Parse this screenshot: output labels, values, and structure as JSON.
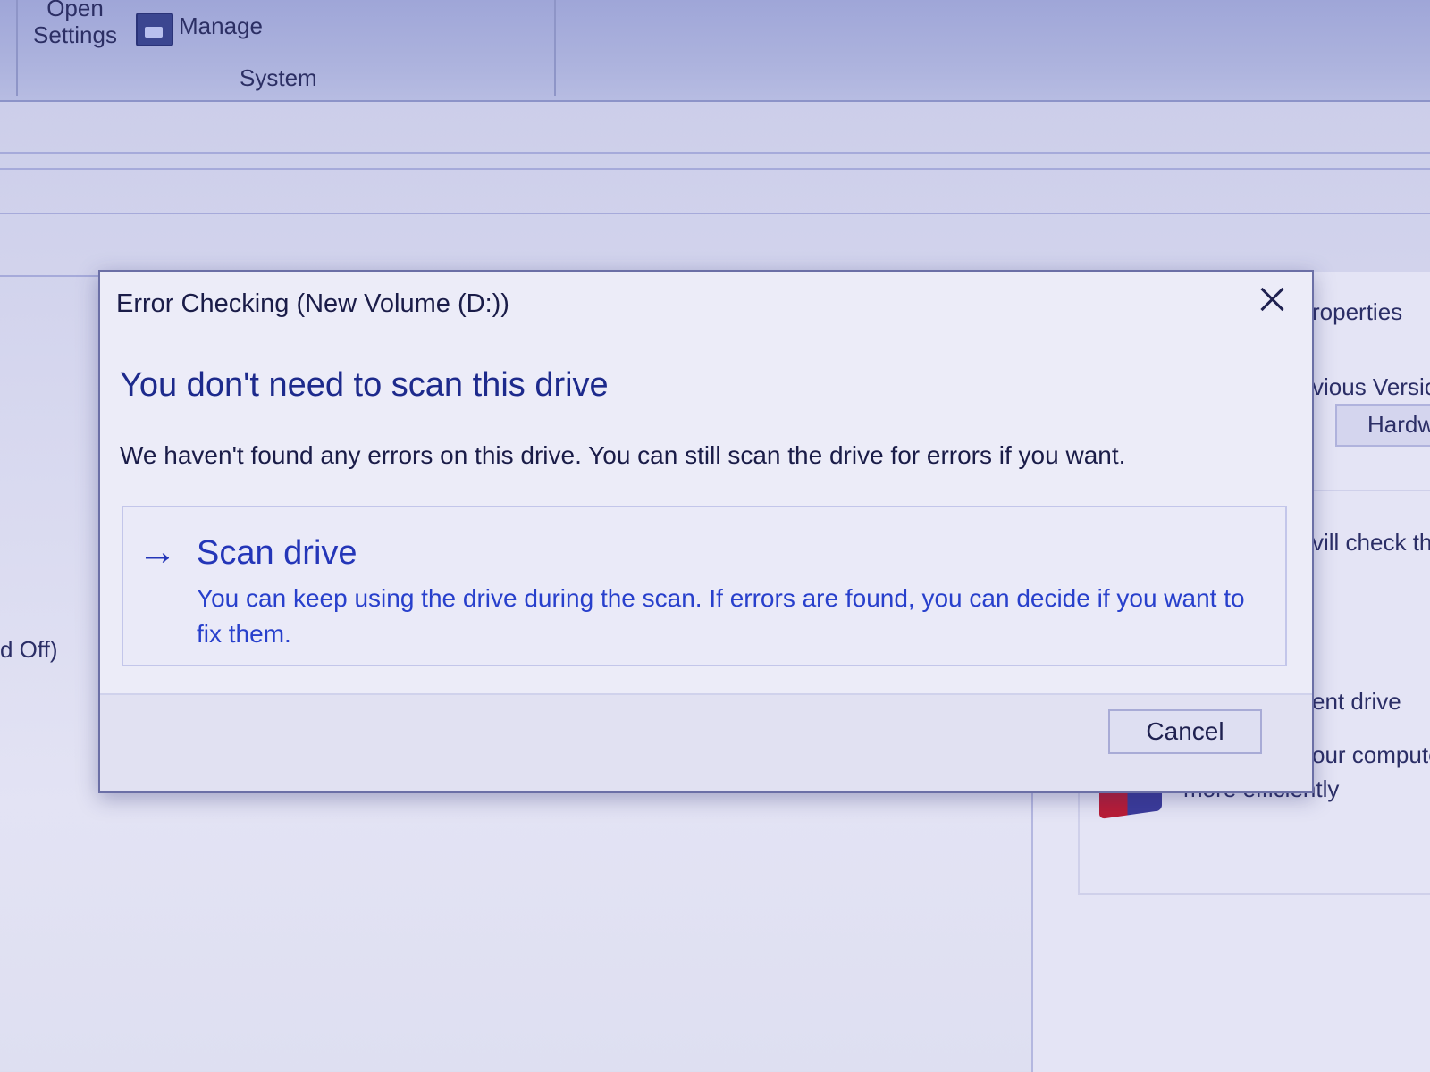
{
  "ribbon": {
    "open_settings_line1": "Open",
    "open_settings_line2": "Settings",
    "manage_label": "Manage",
    "group_label": "System"
  },
  "background": {
    "left_fragment": "d Off)",
    "right_fragments": [
      "roperties",
      "vious Versio",
      "Hardw",
      "vill check th",
      "ent drive",
      "our compute",
      "more efficiently"
    ]
  },
  "dialog": {
    "title": "Error Checking (New Volume (D:))",
    "heading": "You don't need to scan this drive",
    "description": "We haven't found any errors on this drive. You can still scan the drive for errors if you want.",
    "scan_option": {
      "arrow": "→",
      "title": "Scan drive",
      "description": "You can keep using the drive during the scan. If errors are found, you can decide if you want to fix them."
    },
    "cancel_label": "Cancel"
  },
  "colors": {
    "link_blue": "#2436b8",
    "heading_blue": "#1d2a8c",
    "dialog_bg": "#ececf8"
  },
  "icons": {
    "close": "close-icon",
    "manage": "manage-icon",
    "scan_arrow": "arrow-right-icon",
    "defrag": "defrag-icon"
  }
}
